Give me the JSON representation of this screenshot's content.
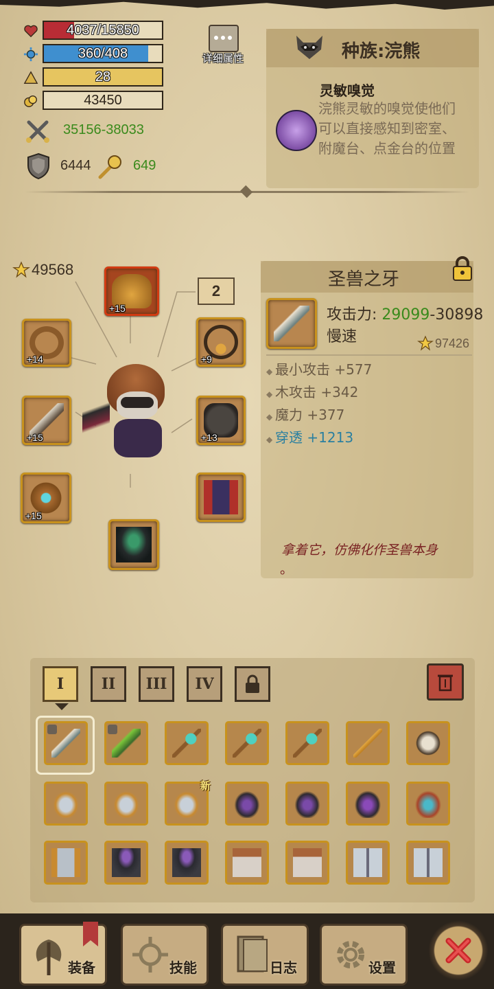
{
  "stats": {
    "hp": {
      "text": "4037/15850",
      "fraction": 0.255,
      "color": "#b82c35"
    },
    "mp": {
      "text": "360/408",
      "fraction": 0.882,
      "color": "#3f8fcf"
    },
    "level": {
      "text": "28",
      "fraction": 1.0,
      "color": "#e6c560"
    },
    "gold": {
      "text": "43450"
    },
    "attack": "35156-38033",
    "defense": "6444",
    "magic": "649"
  },
  "detail_button": {
    "label": "详细属性"
  },
  "race": {
    "title": "种族:浣熊",
    "skill_name": "灵敏嗅觉",
    "skill_desc": "浣熊灵敏的嗅觉使他们可以直接感知到密室、附魔台、点金台的位置"
  },
  "equipment": {
    "power": "49568",
    "set_number": "2",
    "slots": [
      {
        "name": "helmet",
        "level": "+15"
      },
      {
        "name": "ring",
        "level": "+14"
      },
      {
        "name": "amulet",
        "level": "+9"
      },
      {
        "name": "weapon",
        "level": "+15"
      },
      {
        "name": "armor",
        "level": "+13"
      },
      {
        "name": "offhand",
        "level": "+15"
      },
      {
        "name": "pants",
        "level": ""
      },
      {
        "name": "cloak",
        "level": ""
      }
    ]
  },
  "item": {
    "name": "圣兽之牙",
    "attack_label": "攻击力:",
    "attack_min": "29099",
    "attack_max": "-30898",
    "speed": "慢速",
    "power": "97426",
    "attributes": [
      {
        "text": "最小攻击 +577",
        "color": "#6a5a45"
      },
      {
        "text": "木攻击 +342",
        "color": "#6a5a45"
      },
      {
        "text": "魔力 +377",
        "color": "#6a5a45"
      },
      {
        "text": "穿透 +1213",
        "color": "#2a7fa0"
      }
    ],
    "flavor": "拿着它，仿佛化作圣兽本身",
    "flavor_end": "。"
  },
  "inventory": {
    "tabs": [
      "I",
      "II",
      "III",
      "IV"
    ],
    "new_badge": "新"
  },
  "nav": {
    "equip": "装备",
    "skills": "技能",
    "log": "日志",
    "settings": "设置"
  }
}
